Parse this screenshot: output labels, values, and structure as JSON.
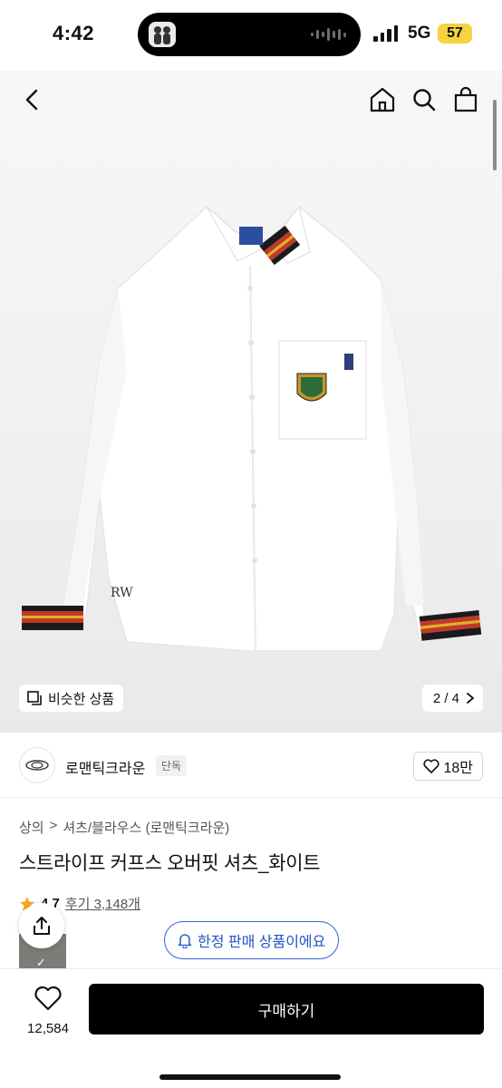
{
  "status_bar": {
    "time": "4:42",
    "network": "5G",
    "battery": "57"
  },
  "nav": {
    "back_icon": "chevron-left-icon",
    "home_icon": "home-icon",
    "search_icon": "search-icon",
    "cart_icon": "shopping-bag-icon"
  },
  "gallery": {
    "similar_label": "비슷한 상품",
    "page_indicator": "2 / 4"
  },
  "brand": {
    "name": "로맨틱크라운",
    "badge": "단독",
    "likes": "18만"
  },
  "breadcrumb": [
    "상의",
    ">",
    "셔츠/블라우스 (로맨틱크라운)"
  ],
  "product": {
    "title": "스트라이프 커프스 오버핏 셔츠_화이트",
    "rating": "4.7",
    "reviews": "후기 3,148개"
  },
  "limited_notice": "한정 판매 상품이에요",
  "bottom": {
    "wish_count": "12,584",
    "buy_label": "구매하기"
  },
  "colors": {
    "accent_blue": "#2f66d6",
    "star": "#f5a623",
    "buy": "#000000"
  }
}
